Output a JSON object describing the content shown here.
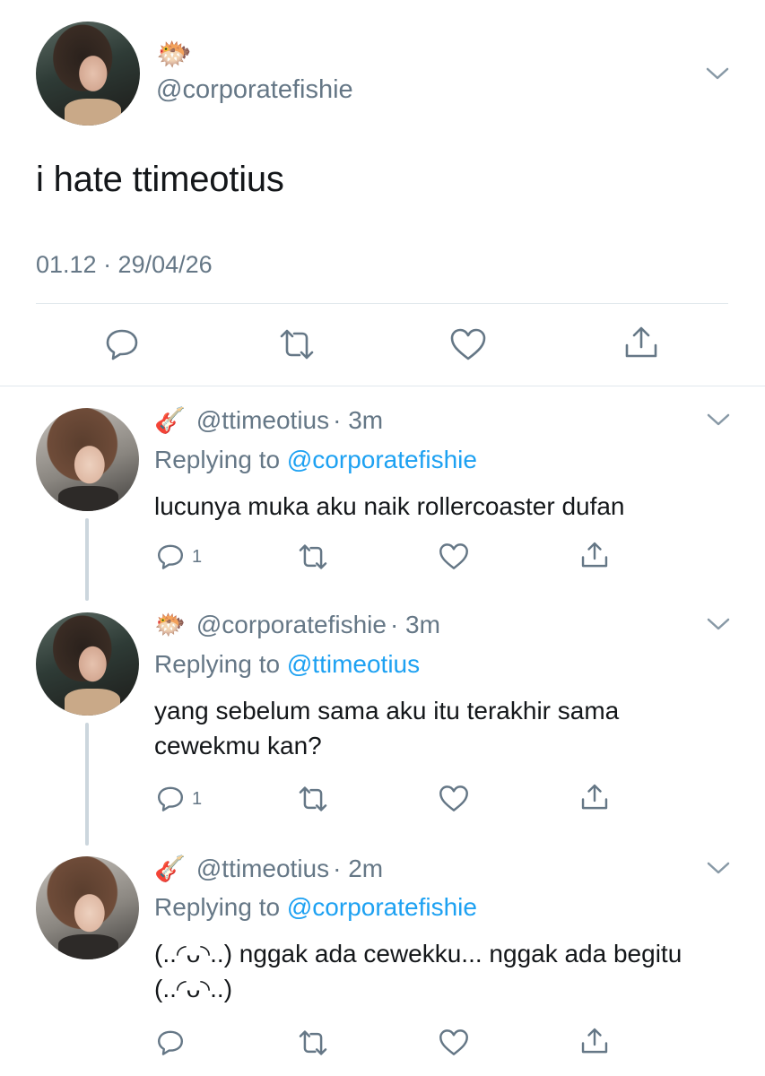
{
  "main_tweet": {
    "emoji": "🐡",
    "handle": "@corporatefishie",
    "text": "i hate ttimeotius",
    "timestamp": "01.12 · 29/04/26",
    "actions": [
      "reply",
      "retweet",
      "like",
      "share"
    ]
  },
  "replies": [
    {
      "emoji": "🎸",
      "handle": "@ttimeotius",
      "time": "· 3m",
      "replying_prefix": "Replying to ",
      "replying_to": "@corporatefishie",
      "text": "lucunya muka aku naik rollercoaster dufan",
      "reply_count": "1"
    },
    {
      "emoji": "🐡",
      "handle": "@corporatefishie",
      "time": "· 3m",
      "replying_prefix": "Replying to ",
      "replying_to": "@ttimeotius",
      "text": "yang sebelum sama aku itu terakhir sama cewekmu kan?",
      "reply_count": "1"
    },
    {
      "emoji": "🎸",
      "handle": "@ttimeotius",
      "time": "· 2m",
      "replying_prefix": "Replying to ",
      "replying_to": "@corporatefishie",
      "text": "(..◜ᴗ◝..) nggak ada cewekku... nggak ada begitu (..◜ᴗ◝..)",
      "reply_count": ""
    }
  ],
  "colors": {
    "text": "#14171a",
    "secondary": "#657786",
    "link": "#1da1f2",
    "divider": "#e1e8ed",
    "thread_line": "#ccd6dd"
  },
  "icons": [
    "chevron-down-icon",
    "reply-icon",
    "retweet-icon",
    "like-icon",
    "share-icon"
  ]
}
